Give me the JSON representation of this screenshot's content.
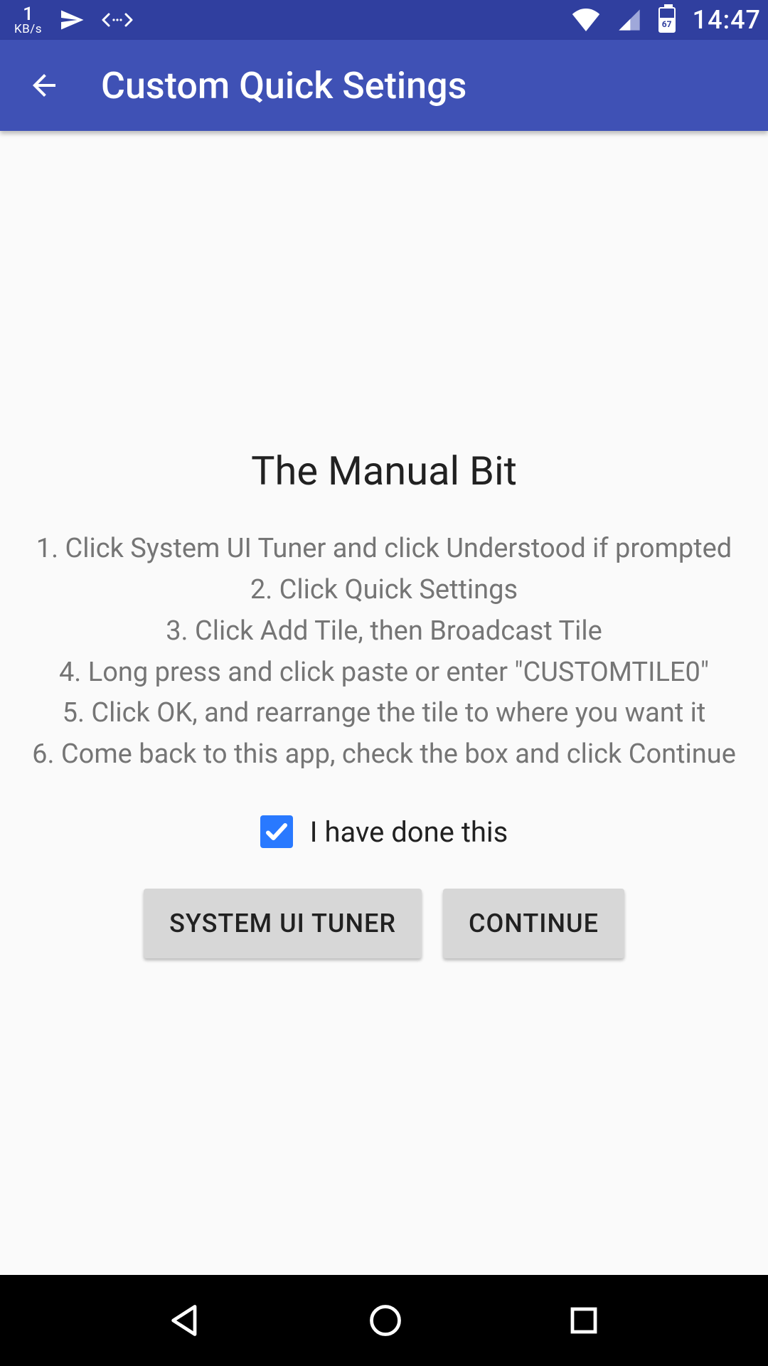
{
  "status_bar": {
    "kbps_value": "1",
    "kbps_unit": "KB/s",
    "battery_level": "67",
    "time": "14:47"
  },
  "app_bar": {
    "title": "Custom Quick Setings"
  },
  "content": {
    "heading": "The Manual Bit",
    "instructions": "1. Click System UI Tuner and click Understood if prompted\n2. Click Quick Settings\n3. Click Add Tile, then Broadcast Tile\n4. Long press and click paste or enter \"CUSTOMTILE0\"\n5. Click OK, and rearrange the tile to where you want it\n6. Come back to this app, check the box and click Continue",
    "checkbox_label": "I have done this",
    "checkbox_checked": true,
    "button_system_ui_tuner": "SYSTEM UI TUNER",
    "button_continue": "CONTINUE"
  },
  "colors": {
    "status_bar_bg": "#303f9f",
    "app_bar_bg": "#3f51b5",
    "accent_checkbox": "#2979ff",
    "button_bg": "#d7d7d7",
    "content_bg": "#fafafa",
    "nav_bg": "#000000"
  }
}
